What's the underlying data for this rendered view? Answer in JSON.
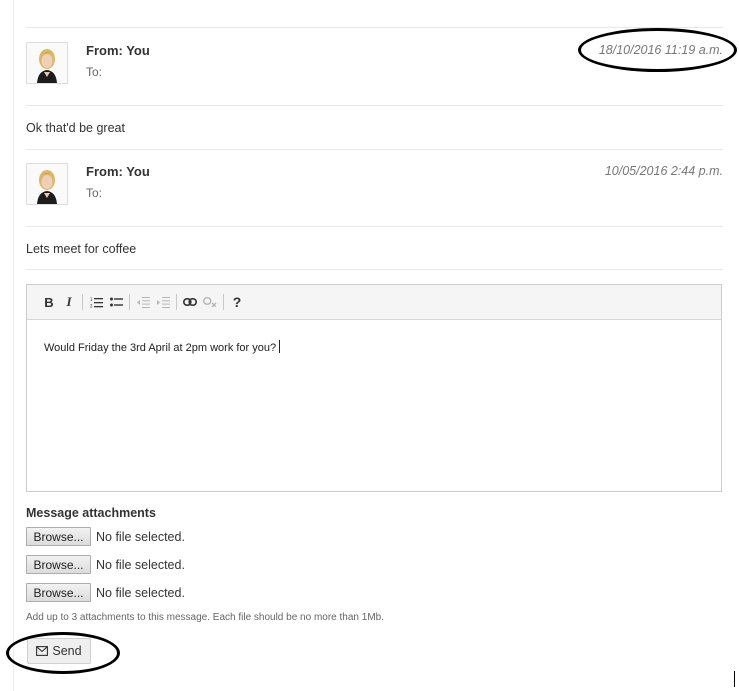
{
  "messages": [
    {
      "from": "From: You",
      "to": "To:",
      "timestamp": "18/10/2016 11:19 a.m.",
      "body": "Ok that'd be great"
    },
    {
      "from": "From: You",
      "to": "To:",
      "timestamp": "10/05/2016 2:44 p.m.",
      "body": "Lets meet for coffee"
    }
  ],
  "editor": {
    "toolbar": [
      "bold-icon",
      "italic-icon",
      "ordered-list-icon",
      "unordered-list-icon",
      "outdent-icon",
      "indent-icon",
      "link-icon",
      "unlink-icon",
      "help-icon"
    ],
    "bold_label": "B",
    "italic_label": "I",
    "help_label": "?",
    "content": "Would Friday the 3rd April at 2pm work for you?"
  },
  "attachments": {
    "title": "Message attachments",
    "browse_label": "Browse...",
    "status": "No file selected.",
    "hint": "Add up to 3 attachments to this message. Each file should be no more than 1Mb."
  },
  "send_label": "Send",
  "annotation_color": "#000000"
}
